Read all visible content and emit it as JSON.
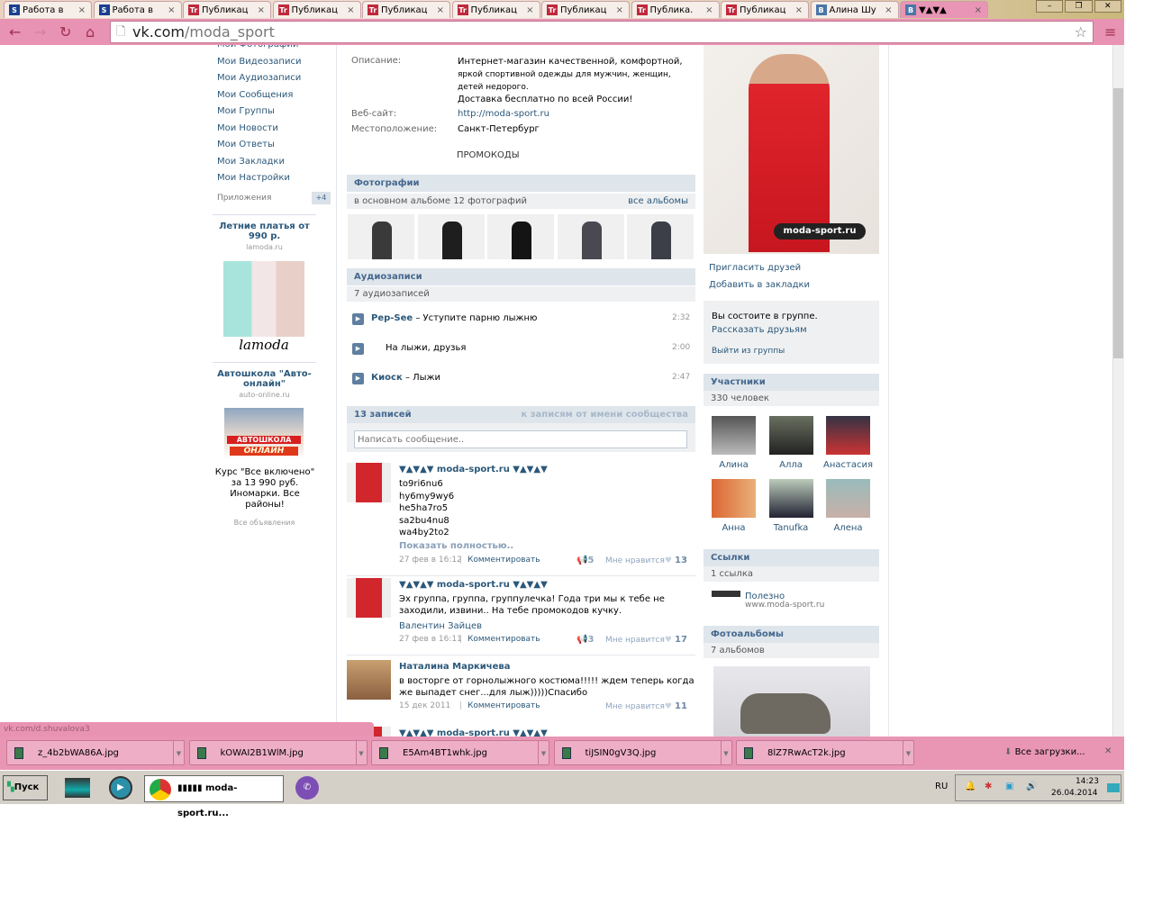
{
  "browser": {
    "tabs": [
      {
        "label": "Работа в",
        "icon": "S"
      },
      {
        "label": "Работа в",
        "icon": "S"
      },
      {
        "label": "Публикац",
        "icon": "Tr"
      },
      {
        "label": "Публикац",
        "icon": "Tr"
      },
      {
        "label": "Публикац",
        "icon": "Tr"
      },
      {
        "label": "Публикац",
        "icon": "Tr"
      },
      {
        "label": "Публикац",
        "icon": "Tr"
      },
      {
        "label": "Публика.",
        "icon": "Tr"
      },
      {
        "label": "Публикац",
        "icon": "Tr"
      },
      {
        "label": "Алина Шу",
        "icon": "B"
      },
      {
        "label": "▼▲▼▲",
        "icon": "B"
      }
    ],
    "url_host": "vk.com",
    "url_path": "/moda_sport",
    "status_url": "vk.com/d.shuvalova3"
  },
  "sidebar": {
    "items": [
      "Мои Фотографии",
      "Мои Видеозаписи",
      "Мои Аудиозаписи",
      "Мои Сообщения",
      "Мои Группы",
      "Мои Новости",
      "Мои Ответы",
      "Мои Закладки",
      "Мои Настройки"
    ],
    "apps_label": "Приложения",
    "apps_count": "+4",
    "ad1": {
      "title": "Летние платья от 990 р.",
      "domain": "lamoda.ru",
      "logo": "lamoda"
    },
    "ad2": {
      "title": "Автошкола \"Авто-онлайн\"",
      "domain": "auto-online.ru",
      "banner1": "АВТОШКОЛА",
      "banner2": "ОНЛАЙН",
      "text": "Курс \"Все включено\" за 13 990 руб. Иномарки. Все районы!"
    },
    "all_ads": "Все объявления"
  },
  "info": {
    "desc_label": "Описание:",
    "desc_lines": [
      "Интернет-магазин качественной, комфортной,",
      "яркой спортивной одежды для мужчин, женщин,",
      "детей недорого.",
      "Доставка бесплатно по всей России!"
    ],
    "site_label": "Веб-сайт:",
    "site": "http://moda-sport.ru",
    "loc_label": "Местоположение:",
    "loc": "Санкт-Петербург",
    "promo": "ПРОМОКОДЫ"
  },
  "photos": {
    "title": "Фотографии",
    "sub": "в основном альбоме 12 фотографий",
    "all": "все альбомы"
  },
  "audio": {
    "title": "Аудиозаписи",
    "sub": "7 аудиозаписей",
    "tracks": [
      {
        "artist": "Pep-See",
        "title": "Уступите парню лыжню",
        "dur": "2:32"
      },
      {
        "artist": "",
        "title": "На лыжи, друзья",
        "dur": "2:00"
      },
      {
        "artist": "Киоск",
        "title": "Лыжи",
        "dur": "2:47"
      }
    ]
  },
  "wall": {
    "count": "13 записей",
    "filter": "к записям от имени сообщества",
    "placeholder": "Написать сообщение..",
    "posts": [
      {
        "author": "▼▲▼▲▼ moda-sport.ru ▼▲▼▲▼",
        "lines": [
          "to9ri6nu6",
          "hy6my9wy6",
          "he5ha7ro5",
          "sa2bu4nu8",
          "wa4by2to2"
        ],
        "more": "Показать полностью..",
        "date": "27 фев в 16:12",
        "comment": "Комментировать",
        "reposts": "5",
        "like_label": "Мне нравится",
        "likes": "13"
      },
      {
        "author": "▼▲▼▲▼ moda-sport.ru ▼▲▼▲▼",
        "lines": [
          "Эх группа, группа, группулечка! Года три мы к тебе не",
          "заходили, извини.. На тебе промокодов кучку."
        ],
        "signer": "Валентин Зайцев",
        "date": "27 фев в 16:11",
        "comment": "Комментировать",
        "reposts": "3",
        "like_label": "Мне нравится",
        "likes": "17"
      },
      {
        "author": "Наталина Маркичева",
        "lines": [
          "в восторге от горнолыжного костюма!!!!! ждем теперь когда",
          "же выпадет снег...для лыж)))))Спасибо"
        ],
        "date": "15 дек 2011",
        "comment": "Комментировать",
        "like_label": "Мне нравится",
        "likes": "11"
      },
      {
        "author": "▼▲▼▲▼ moda-sport.ru ▼▲▼▲▼"
      }
    ]
  },
  "right": {
    "logo": "moda-sport.ru",
    "invite": "Пригласить друзей",
    "bookmark": "Добавить в закладки",
    "member_text": "Вы состоите в группе.",
    "tell": "Рассказать друзьям",
    "leave": "Выйти из группы",
    "members_title": "Участники",
    "members_count": "330 человек",
    "members": [
      "Алина",
      "Алла",
      "Анастасия",
      "Анна",
      "Tanufka",
      "Алена"
    ],
    "links_title": "Ссылки",
    "links_count": "1 ссылка",
    "link_name": "Полезно",
    "link_url": "www.moda-sport.ru",
    "albums_title": "Фотоальбомы",
    "albums_count": "7 альбомов"
  },
  "downloads": {
    "files": [
      "z_4b2bWA86A.jpg",
      "kOWAI2B1WlM.jpg",
      "E5Am4BT1whk.jpg",
      "tiJSIN0gV3Q.jpg",
      "8lZ7RwAcT2k.jpg"
    ],
    "all": "Все загрузки..."
  },
  "taskbar": {
    "start": "Пуск",
    "window": "▮▮▮▮▮ moda-sport.ru...",
    "lang": "RU",
    "time": "14:23",
    "date": "26.04.2014"
  }
}
